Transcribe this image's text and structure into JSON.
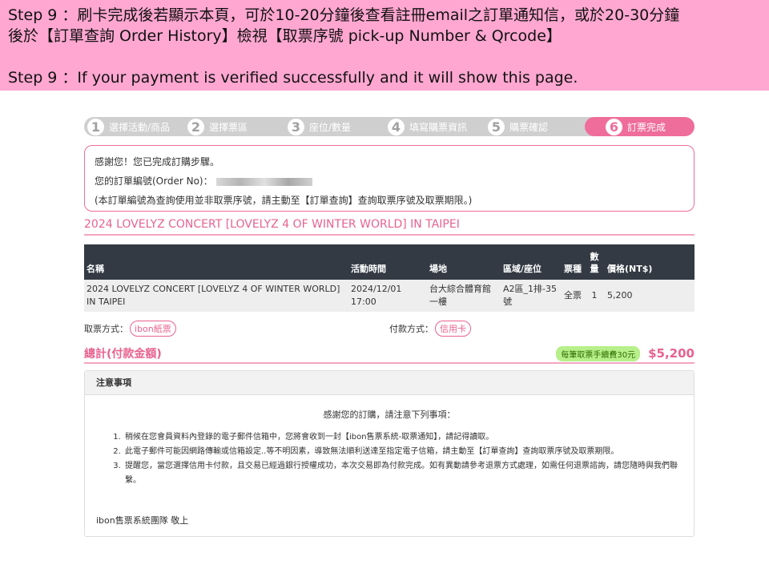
{
  "banner": {
    "line1": "Step 9 ：刷卡完成後若顯示本頁，可於10-20分鐘後查看註冊email之訂單通知信，或於20-30分鐘",
    "line2": "後於【訂單查詢 Order History】檢視【取票序號 pick-up Number & Qrcode】",
    "line3": "Step 9 ：If your payment is verified successfully and it will show this page."
  },
  "steps": [
    {
      "num": "1",
      "label": "選擇活動/商品"
    },
    {
      "num": "2",
      "label": "選擇票區"
    },
    {
      "num": "3",
      "label": "座位/數量"
    },
    {
      "num": "4",
      "label": "填寫購票資訊"
    },
    {
      "num": "5",
      "label": "購票確認"
    },
    {
      "num": "6",
      "label": "訂票完成"
    }
  ],
  "thanks": {
    "line1": "感謝您！您已完成訂購步驟。",
    "order_label": "您的訂單編號(Order No)：",
    "line3": "(本訂單編號為查詢使用並非取票序號，請主動至【訂單查詢】查詢取票序號及取票期限。)"
  },
  "event_title": "2024 LOVELYZ CONCERT [LOVELYZ 4 OF WINTER WORLD] IN TAIPEI",
  "table": {
    "headers": {
      "name": "名稱",
      "time": "活動時間",
      "venue": "場地",
      "area": "區域/座位",
      "ticket_type": "票種",
      "qty": "數量",
      "price": "價格(NT$)"
    },
    "row": {
      "name": "2024 LOVELYZ CONCERT [LOVELYZ 4 OF WINTER WORLD] IN TAIPEI",
      "time": "2024/12/01 17:00",
      "venue": "台大綜合體育館一樓",
      "area": "A2區_1排-35號",
      "ticket_type": "全票",
      "qty": "1",
      "price": "5,200"
    }
  },
  "pickup": {
    "label": "取票方式：",
    "value": "ibon紙票"
  },
  "payment": {
    "label": "付款方式：",
    "value": "信用卡"
  },
  "total": {
    "label": "總計(付款金額)",
    "fee_badge": "每筆取票手續費30元",
    "amount": "$5,200"
  },
  "notice": {
    "title": "注意事項",
    "intro": "感謝您的訂購，請注意下列事項：",
    "items": [
      "稍候在您會員資料內登錄的電子郵件信箱中，您將會收到一封【ibon售票系統-取票通知】，請記得讀取。",
      "此電子郵件可能因網路傳輸或信箱設定..等不明因素，導致無法順利送達至指定電子信箱，請主動至【訂單查詢】查詢取票序號及取票期限。",
      "提醒您，當您選擇信用卡付款，且交易已經過銀行授權成功，本次交易即為付款完成。如有異動請參考退票方式處理，如需任何退票諮詢，請您隨時與我們聯繫。"
    ],
    "signature": "ibon售票系統團隊  敬上"
  },
  "colors": {
    "banner": "#ffa7d1",
    "accent": "#e8628f",
    "header_dark": "#333a43"
  }
}
